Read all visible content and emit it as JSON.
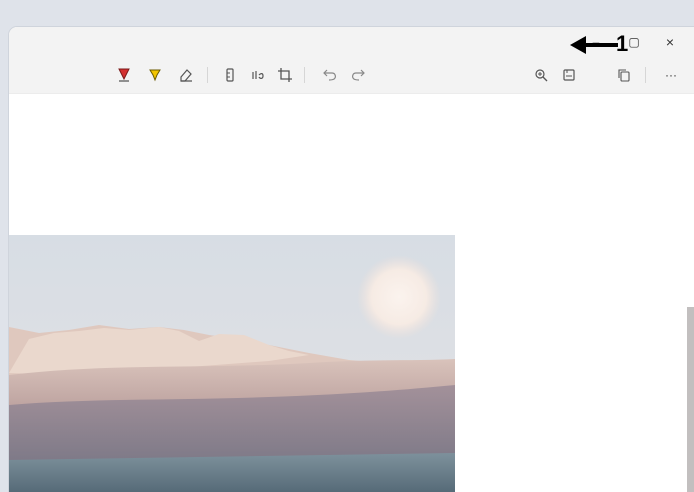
{
  "window": {
    "caption": {
      "minimize_symbol": "–",
      "maximize_symbol": "▢",
      "close_symbol": "×"
    }
  },
  "toolbar": {
    "colors": {
      "pen_red": "#d32f2f",
      "highlighter_yellow": "#f2c500",
      "icon_gray": "#555555"
    },
    "left_group": [
      "ballpoint-pen-icon",
      "highlighter-icon",
      "eraser-icon",
      "ruler-icon",
      "touch-writing-icon",
      "crop-icon",
      "undo-icon",
      "redo-icon"
    ],
    "right_group": [
      "zoom-icon",
      "save-icon",
      "copy-icon",
      "more-icon"
    ],
    "more_symbol": "···"
  },
  "annotation": {
    "label": "1"
  },
  "image": {
    "description_colors": {
      "sky": "#d8dde4",
      "sun": "#f6ece6",
      "mountains": "#e9d4c8",
      "dunes": "#c7aeaa",
      "water": "#6e8491"
    }
  }
}
